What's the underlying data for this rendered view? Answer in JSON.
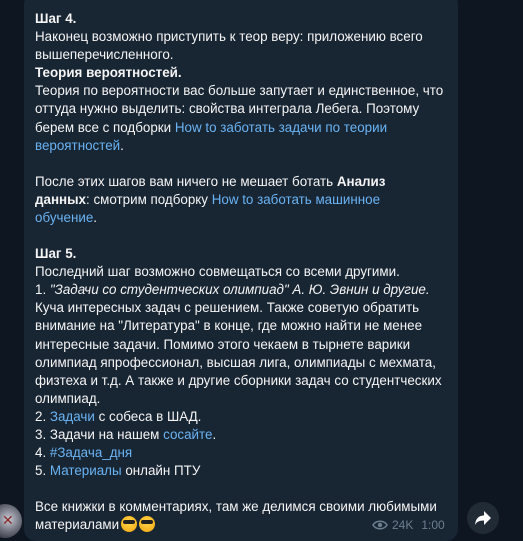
{
  "post": {
    "step4_title": "Шаг 4.",
    "step4_line1": "Наконец возможно приступить к теор веру: приложению всего",
    "step4_line2": "вышеперечисленного.",
    "prob_title": "Теория вероятностей.",
    "prob_line1": "Теория по вероятности вас больше запутает и единственное, что",
    "prob_line2": "оттуда нужно выделить: свойства интеграла Лебега. Поэтому",
    "prob_line3_text": "берем все с подборки ",
    "prob_link_part1": "How to заботать задачи по теории",
    "prob_link_part2": "вероятностей",
    "prob_line4_tail": ".",
    "ad_line1_text": "После этих шагов вам ничего не мешает ботать ",
    "ad_line1_bold": "Анализ",
    "ad_line2_bold": "данных",
    "ad_line2_text": ": смотрим подборку ",
    "ad_link_part1": "How to заботать машинное",
    "ad_link_part2": "обучение",
    "ad_line3_tail": ".",
    "step5_title": "Шаг 5.",
    "step5_line1": "Последний шаг возможно совмещаться со всеми другими.",
    "item1_num": "1. ",
    "item1_italic": "\"Задачи со студентческих олимпиад\" А. Ю. Эвнин и другие.",
    "item1_line2": "Куча интересных задач с решением. Также советую обратить",
    "item1_line3": "внимание на \"Литература\" в конце, где можно найти не менее",
    "item1_line4": "интересные задачи. Помимо этого чекаем в тырнете варики",
    "item1_line5": "олимпиад япрофессионал, высшая лига, олимпиады с мехмата,",
    "item1_line6": "физтеха и т.д. А также и другие сборники задач со студентческих",
    "item1_line7": "олимпиад.",
    "item2_num": "2. ",
    "item2_link": "Задачи",
    "item2_text": " с собеса в ШАД.",
    "item3_text": "3. Задачи на нашем ",
    "item3_link": "сосайте",
    "item3_tail": ".",
    "item4_num": "4. ",
    "item4_link": "#Задача_дня",
    "item5_num": "5. ",
    "item5_link": "Материалы",
    "item5_text": " онлайн ПТУ",
    "footer_line1": "Все книжки в комментариях, там же делимся своими любимыми",
    "footer_line2": "материалами"
  },
  "meta": {
    "views": "24K",
    "time": "1:00"
  },
  "icons": {
    "views": "eye-icon",
    "share": "share-arrow-icon",
    "emoji": "sunglasses-emoji-icon"
  },
  "colors": {
    "background": "#0e1621",
    "bubble": "#182533",
    "text": "#f5f5f5",
    "link": "#6ab3f3",
    "meta": "#6d7f8f"
  }
}
